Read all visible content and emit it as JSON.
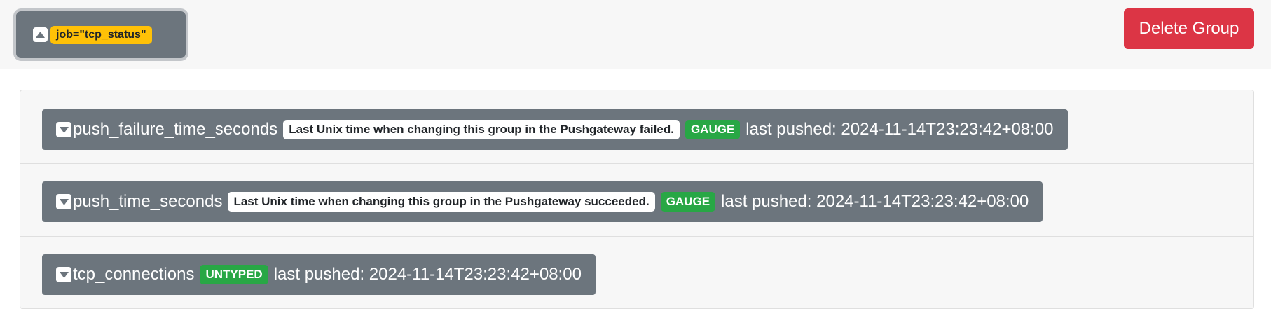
{
  "group": {
    "label": "job=\"tcp_status\"",
    "delete_label": "Delete Group"
  },
  "metrics": [
    {
      "name": "push_failure_time_seconds",
      "help": "Last Unix time when changing this group in the Pushgateway failed.",
      "type": "GAUGE",
      "last_pushed": "last pushed: 2024-11-14T23:23:42+08:00"
    },
    {
      "name": "push_time_seconds",
      "help": "Last Unix time when changing this group in the Pushgateway succeeded.",
      "type": "GAUGE",
      "last_pushed": "last pushed: 2024-11-14T23:23:42+08:00"
    },
    {
      "name": "tcp_connections",
      "type": "UNTYPED",
      "last_pushed": "last pushed: 2024-11-14T23:23:42+08:00"
    }
  ],
  "colors": {
    "bar": "#6c757d",
    "label": "#ffc107",
    "type": "#28a745",
    "danger": "#dc3545"
  },
  "icons": {
    "group_toggle": "caret-up-square-icon",
    "metric_toggle": "caret-down-square-icon"
  }
}
